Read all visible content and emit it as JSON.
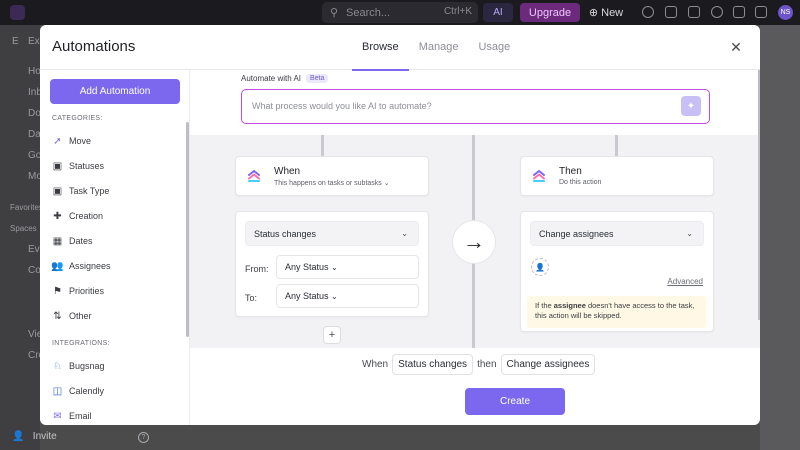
{
  "topbar": {
    "search_placeholder": "Search...",
    "search_shortcut": "Ctrl+K",
    "ai_label": "AI",
    "upgrade_label": "Upgrade",
    "new_label": "New",
    "avatar_initials": "NS"
  },
  "background": {
    "sidebar_items": [
      "Ho",
      "Inb",
      "Do",
      "Da",
      "Go",
      "Mo"
    ],
    "favorites_label": "Favorites",
    "spaces_label": "Spaces",
    "space_items": [
      "Ev",
      "Co",
      "Vie",
      "Cre"
    ],
    "workspace_initial": "E",
    "workspace_label": "Ex",
    "invite_label": "Invite"
  },
  "modal": {
    "title": "Automations",
    "tabs": [
      {
        "label": "Browse",
        "active": true
      },
      {
        "label": "Manage",
        "active": false
      },
      {
        "label": "Usage",
        "active": false
      }
    ],
    "add_button": "Add Automation",
    "categories_label": "CATEGORIES:",
    "categories": [
      {
        "label": "Move",
        "icon": "move-icon"
      },
      {
        "label": "Statuses",
        "icon": "status-icon"
      },
      {
        "label": "Task Type",
        "icon": "task-type-icon"
      },
      {
        "label": "Creation",
        "icon": "creation-icon"
      },
      {
        "label": "Dates",
        "icon": "calendar-icon"
      },
      {
        "label": "Assignees",
        "icon": "assignees-icon"
      },
      {
        "label": "Priorities",
        "icon": "flag-icon"
      },
      {
        "label": "Other",
        "icon": "other-icon"
      }
    ],
    "integrations_label": "INTEGRATIONS:",
    "integrations": [
      {
        "label": "Bugsnag",
        "icon": "bugsnag-icon"
      },
      {
        "label": "Calendly",
        "icon": "calendly-icon"
      },
      {
        "label": "Email",
        "icon": "email-icon"
      }
    ],
    "ai": {
      "label": "Automate with AI",
      "badge": "Beta",
      "placeholder": "What process would you like AI to automate?"
    },
    "when": {
      "title": "When",
      "subtitle": "This happens on tasks or subtasks",
      "trigger": "Status changes",
      "from_label": "From:",
      "from_value": "Any Status",
      "to_label": "To:",
      "to_value": "Any Status"
    },
    "then": {
      "title": "Then",
      "subtitle": "Do this action",
      "action": "Change assignees",
      "advanced": "Advanced",
      "warning_prefix": "If the ",
      "warning_bold": "assignee",
      "warning_suffix": " doesn't have access to the task, this action will be skipped."
    },
    "sentence": {
      "when": "When",
      "trigger_chip": "Status changes",
      "then": "then",
      "action_chip": "Change assignees"
    },
    "create_button": "Create"
  },
  "colors": {
    "accent": "#7b68ee",
    "ai_border": "#c64be0",
    "warning_bg": "#fef8e4"
  }
}
